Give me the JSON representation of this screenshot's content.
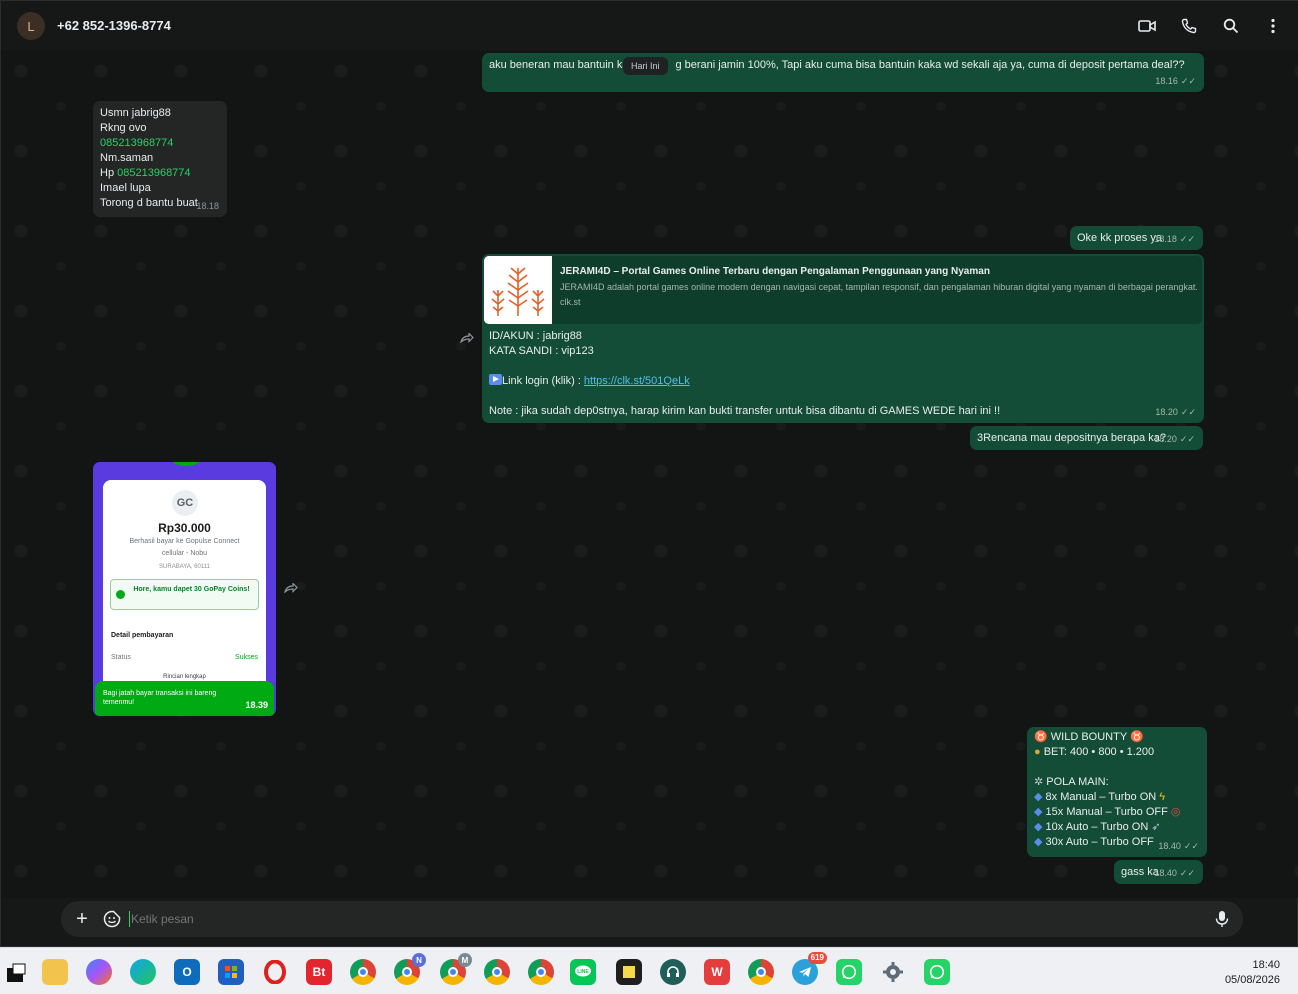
{
  "header": {
    "avatar_letter": "L",
    "contact": "+62 852-1396-8774"
  },
  "date_badge": "Hari Ini",
  "messages": {
    "m1": {
      "text": "aku beneran mau bantuin ka",
      "text2": "g berani jamin 100%, Tapi aku cuma bisa bantuin kaka wd sekali aja ya, cuma di deposit pertama deal??",
      "time": "18.16"
    },
    "m2": {
      "l1": "Usmn jabrig88",
      "l2": "Rkng ovo",
      "l3": "085213968774",
      "l4": "Nm.saman",
      "l5a": "Hp ",
      "l5b": "085213968774",
      "l6": "Imael lupa",
      "l7": "Torong d bantu buat",
      "time": "18.18"
    },
    "m3": {
      "text": "Oke kk proses ya",
      "time": "18.18"
    },
    "m4": {
      "preview_title": "JERAMI4D – Portal Games Online Terbaru dengan Pengalaman Penggunaan yang Nyaman",
      "preview_desc": "JERAMI4D adalah portal games online modern dengan navigasi cepat, tampilan responsif, dan pengalaman hiburan digital yang nyaman di berbagai perangkat.",
      "preview_domain": "clk.st",
      "l1": "ID/AKUN : jabrig88",
      "l2": "KATA SANDI  : vip123",
      "l3a": "Link login (klik) : ",
      "l3b": "https://clk.st/501QeLk",
      "l4": "Note : jika sudah dep0stnya, harap kirim kan bukti  transfer untuk bisa dibantu di GAMES WEDE hari ini !!",
      "time": "18.20"
    },
    "m5": {
      "text": "3Rencana mau depositnya berapa ka?",
      "time": "18.20"
    },
    "m6": {
      "logo": "GC",
      "amount": "Rp30.000",
      "desc1": "Berhasil bayar ke Gopulse Connect",
      "desc2": "cellular - Nobu",
      "city": "SURABAYA, 60111",
      "coins": "Hore, kamu dapet 30 GoPay Coins!",
      "detail": "Detail pembayaran",
      "status_label": "Status",
      "status_value": "Sukses",
      "rincian": "Rincian lengkap",
      "footer": "Bagi jatah bayar transaksi ini bareng temenmu!",
      "time": "18.39"
    },
    "m7": {
      "l1": "WILD BOUNTY",
      "l2": "BET: 400 • 800 • 1.200",
      "l3": "POLA MAIN:",
      "l4": "8x Manual – Turbo ON",
      "l5": "15x Manual – Turbo OFF",
      "l6": "10x Auto – Turbo ON",
      "l7": "30x Auto – Turbo OFF",
      "time": "18.40"
    },
    "m8": {
      "text": "gass ka",
      "time": "18.40"
    }
  },
  "composer": {
    "placeholder": "Ketik pesan"
  },
  "taskbar": {
    "badge_count": "619",
    "chrome_n": "N",
    "chrome_m": "M",
    "bt": "Bt",
    "time": "18:40",
    "date": "05/08/2026"
  }
}
